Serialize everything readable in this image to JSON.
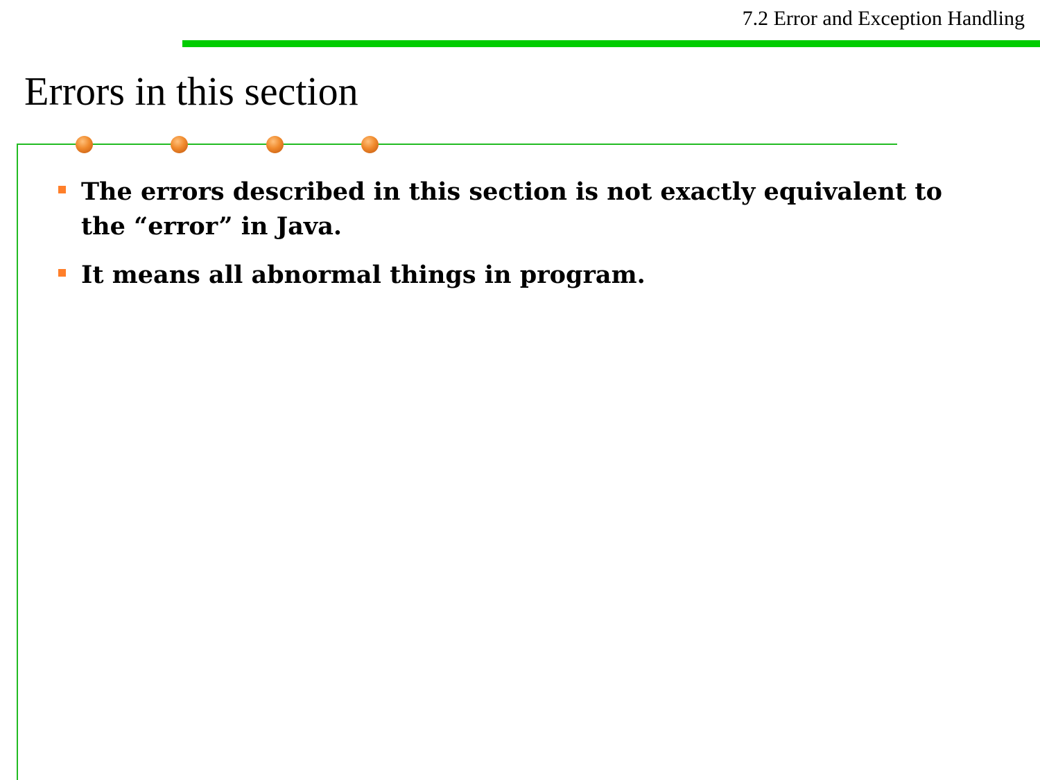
{
  "header": {
    "section_title": "7.2 Error and Exception Handling",
    "bar_color": "#00cc00"
  },
  "slide": {
    "title": "Errors in this section",
    "accent_color": "#f08a2c",
    "rule_color": "#22bb22"
  },
  "bullets": [
    {
      "text": "The errors described in this section is not exactly equivalent to the “error” in Java."
    },
    {
      "text": "It means all abnormal things in program."
    }
  ]
}
